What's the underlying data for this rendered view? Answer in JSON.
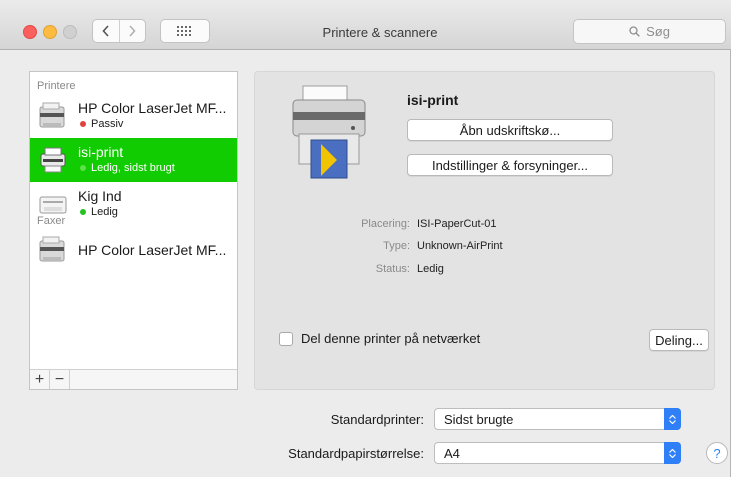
{
  "window": {
    "title": "Printere & scannere"
  },
  "search": {
    "placeholder": "Søg"
  },
  "sidebar": {
    "printers_header": "Printere",
    "fax_header": "Faxer",
    "printers": [
      {
        "name": "HP Color LaserJet MF...",
        "status": "Passiv",
        "status_color": "#e0443e"
      },
      {
        "name": "isi-print",
        "status": "Ledig, sidst brugt",
        "status_color": "#5ee14a"
      },
      {
        "name": "Kig Ind",
        "status": "Ledig",
        "status_color": "#25c221"
      }
    ],
    "faxes": [
      {
        "name": "HP Color LaserJet MF..."
      }
    ],
    "add_label": "+",
    "remove_label": "−"
  },
  "detail": {
    "printer_name": "isi-print",
    "open_queue_label": "Åbn udskriftskø...",
    "options_label": "Indstillinger & forsyninger...",
    "location_key": "Placering:",
    "location_value": "ISI-PaperCut-01",
    "type_key": "Type:",
    "type_value": "Unknown-AirPrint",
    "status_key": "Status:",
    "status_value": "Ledig",
    "share_label": "Del denne printer på netværket",
    "sharing_button": "Deling..."
  },
  "defaults": {
    "printer_label": "Standardprinter:",
    "printer_value": "Sidst brugte",
    "paper_label": "Standardpapirstørrelse:",
    "paper_value": "A4"
  },
  "help_label": "?",
  "colors": {
    "selection": "#11cc00",
    "accent": "#2f7ff6"
  }
}
